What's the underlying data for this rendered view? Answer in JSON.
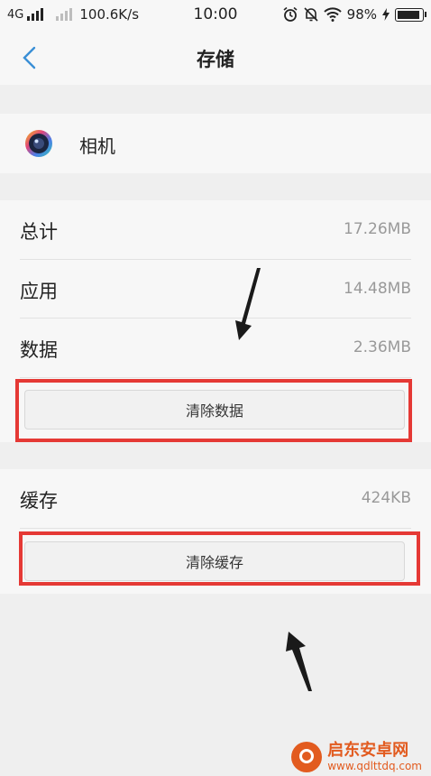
{
  "status_bar": {
    "network": "4G",
    "speed": "100.6K/s",
    "time": "10:00",
    "battery": "98%",
    "battery_level": 0.98,
    "icons": [
      "alarm-icon",
      "mute-icon",
      "wifi-icon",
      "charging-icon"
    ]
  },
  "header": {
    "back_icon": "chevron-left-icon",
    "title": "存储",
    "accent_color": "#3a8fd6"
  },
  "app": {
    "icon": "camera-app-icon",
    "name": "相机"
  },
  "storage": {
    "rows": [
      {
        "label": "总计",
        "value": "17.26MB"
      },
      {
        "label": "应用",
        "value": "14.48MB"
      },
      {
        "label": "数据",
        "value": "2.36MB"
      }
    ],
    "clear_data_label": "清除数据"
  },
  "cache": {
    "label": "缓存",
    "value": "424KB",
    "clear_cache_label": "清除缓存"
  },
  "annotations": {
    "highlight_color": "#e53935",
    "arrow_color": "#1a1a1a"
  },
  "watermark": {
    "name": "启东安卓网",
    "url": "www.qdlttdq.com"
  }
}
